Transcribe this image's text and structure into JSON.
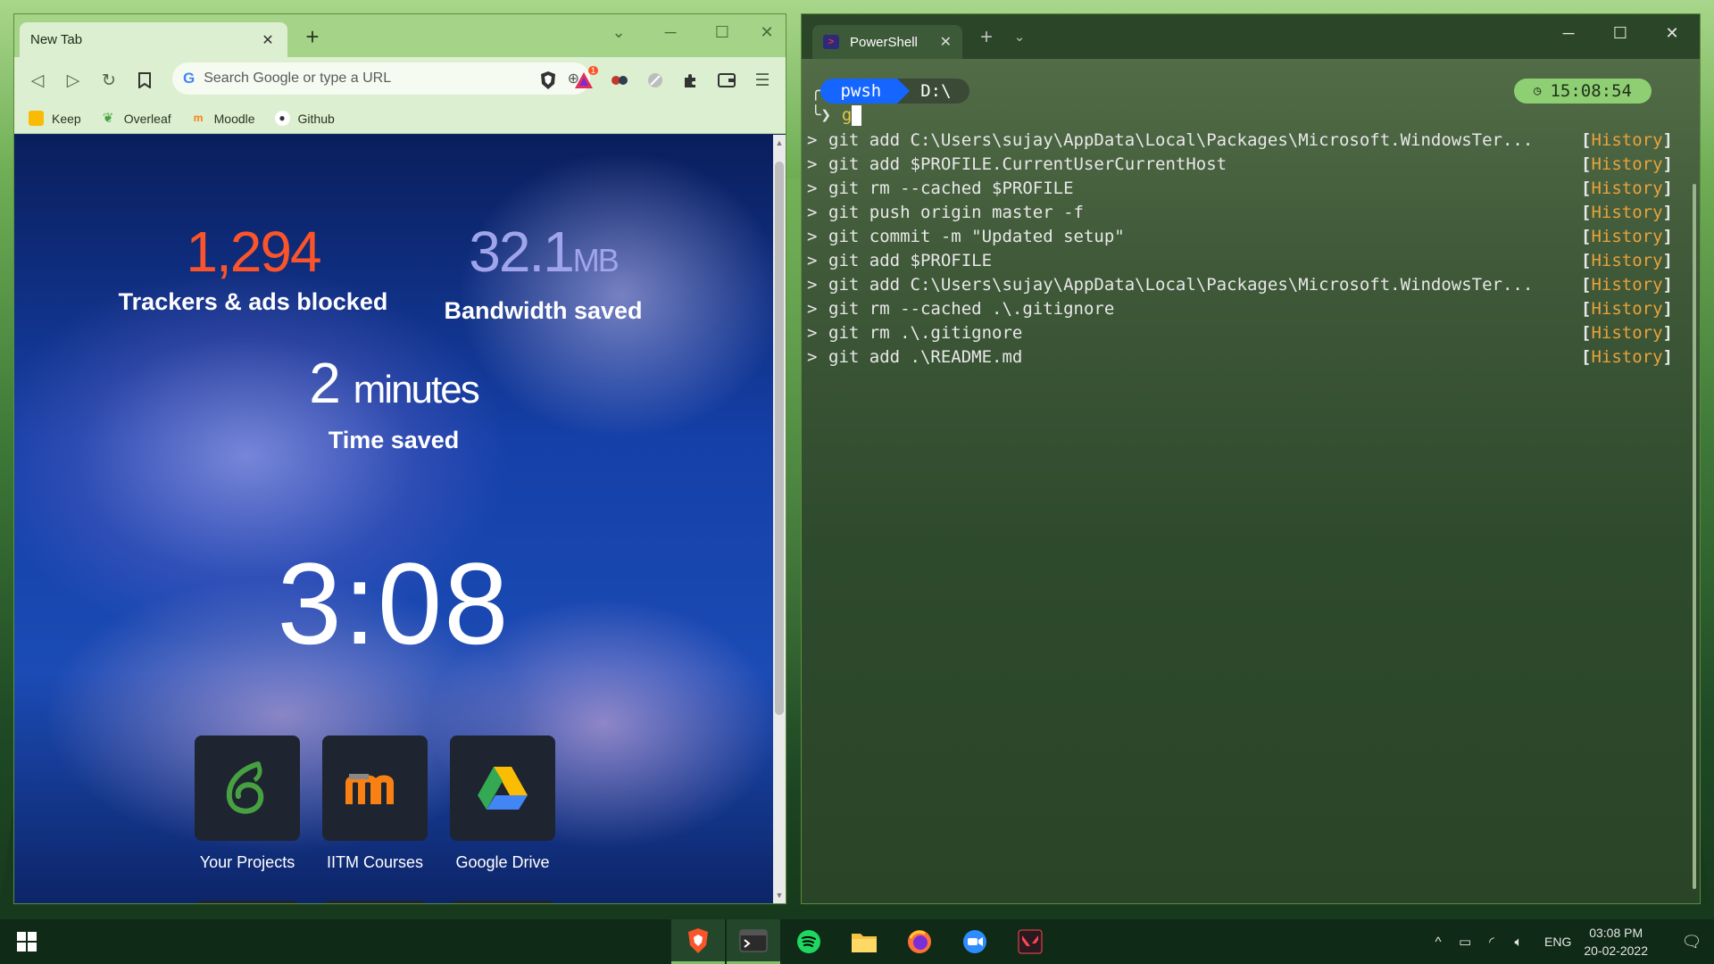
{
  "browser": {
    "tab_title": "New Tab",
    "tab_close": "✕",
    "new_tab": "+",
    "search_placeholder": "Search Google or type a URL",
    "bookmarks": [
      {
        "label": "Keep",
        "color": "#f9bb04"
      },
      {
        "label": "Overleaf",
        "color": "#47a141"
      },
      {
        "label": "Moodle",
        "color": "#f98012"
      },
      {
        "label": "Github",
        "color": "#333333"
      }
    ],
    "shields_badge": "1",
    "stats": {
      "trackers_value": "1,294",
      "trackers_label": "Trackers & ads blocked",
      "bandwidth_value": "32.1",
      "bandwidth_unit": "MB",
      "bandwidth_label": "Bandwidth saved",
      "time_value": "2",
      "time_unit": "minutes",
      "time_label": "Time saved"
    },
    "clock": "3:08",
    "tiles": [
      {
        "label": "Your Projects"
      },
      {
        "label": "IITM Courses"
      },
      {
        "label": "Google Drive"
      }
    ],
    "colors": {
      "trackers": "#fb542b",
      "bandwidth": "#a0a5eb",
      "chrome": "#dcefd0"
    }
  },
  "terminal": {
    "tab_title": "PowerShell",
    "tab_close": "✕",
    "new_tab": "+",
    "dropdown": "⌄",
    "prompt_shell": "pwsh",
    "prompt_path": "D:\\",
    "time": "15:08:54",
    "input_arrow": "╰❯",
    "typed": "g",
    "history_gt": ">",
    "history_tag_open": "[",
    "history_tag_word": "History",
    "history_tag_close": "]",
    "history": [
      "git add C:\\Users\\sujay\\AppData\\Local\\Packages\\Microsoft.WindowsTer...",
      "git add $PROFILE.CurrentUserCurrentHost",
      "git rm --cached $PROFILE",
      "git push origin master -f",
      "git commit -m \"Updated setup\"",
      "git add $PROFILE",
      "git add C:\\Users\\sujay\\AppData\\Local\\Packages\\Microsoft.WindowsTer...",
      "git rm --cached .\\.gitignore",
      "git rm .\\.gitignore",
      "git add .\\README.md"
    ]
  },
  "taskbar": {
    "apps": [
      {
        "name": "brave"
      },
      {
        "name": "terminal"
      },
      {
        "name": "spotify"
      },
      {
        "name": "file-explorer"
      },
      {
        "name": "firefox"
      },
      {
        "name": "zoom"
      },
      {
        "name": "valorant"
      }
    ],
    "lang": "ENG",
    "time": "03:08 PM",
    "date": "20-02-2022"
  }
}
